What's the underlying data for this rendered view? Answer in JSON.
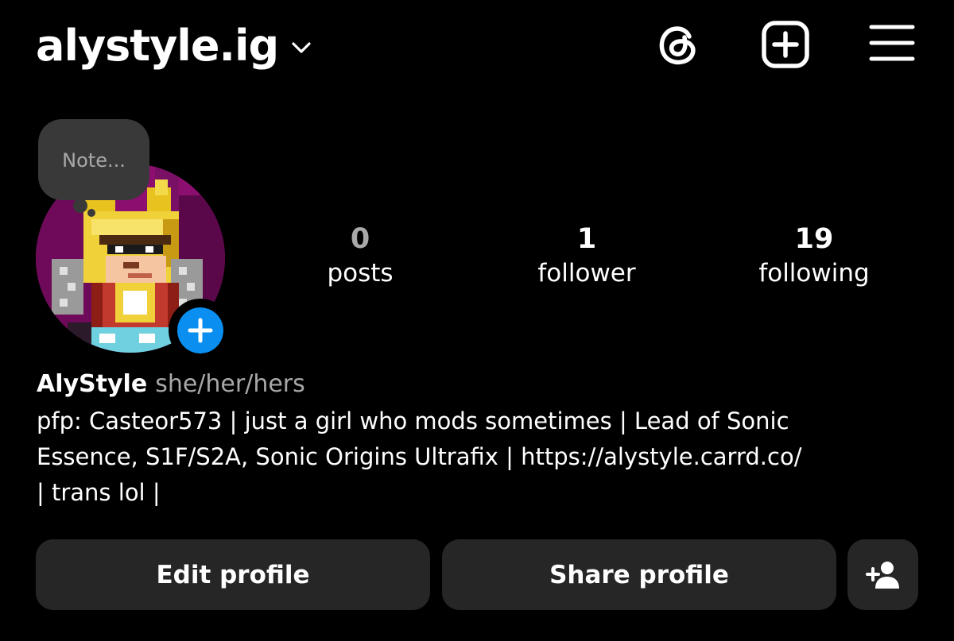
{
  "header": {
    "username": "alystyle.ig",
    "account_switcher_icon": "chevron-down-icon",
    "icons": [
      "threads-icon",
      "create-post-icon",
      "menu-icon"
    ]
  },
  "note": {
    "placeholder": "Note..."
  },
  "profile": {
    "avatar_description": "pixel-art avatar",
    "add_story_icon": "plus-icon",
    "accent_color": "#0A8FF0"
  },
  "stats": [
    {
      "count": "0",
      "label": "posts"
    },
    {
      "count": "1",
      "label": "follower"
    },
    {
      "count": "19",
      "label": "following"
    }
  ],
  "bio": {
    "display_name": "AlyStyle",
    "pronouns": "she/her/hers",
    "text": "pfp: Casteor573 | just a girl who mods sometimes | Lead of Sonic\nEssence, S1F/S2A, Sonic Origins Ultrafix | https://alystyle.carrd.co/\n| trans lol |"
  },
  "actions": {
    "edit_label": "Edit profile",
    "share_label": "Share profile",
    "discover_people_icon": "add-person-icon"
  },
  "colors": {
    "background": "#000000",
    "button_bg": "#262626",
    "secondary_text": "#A8A8A8"
  }
}
